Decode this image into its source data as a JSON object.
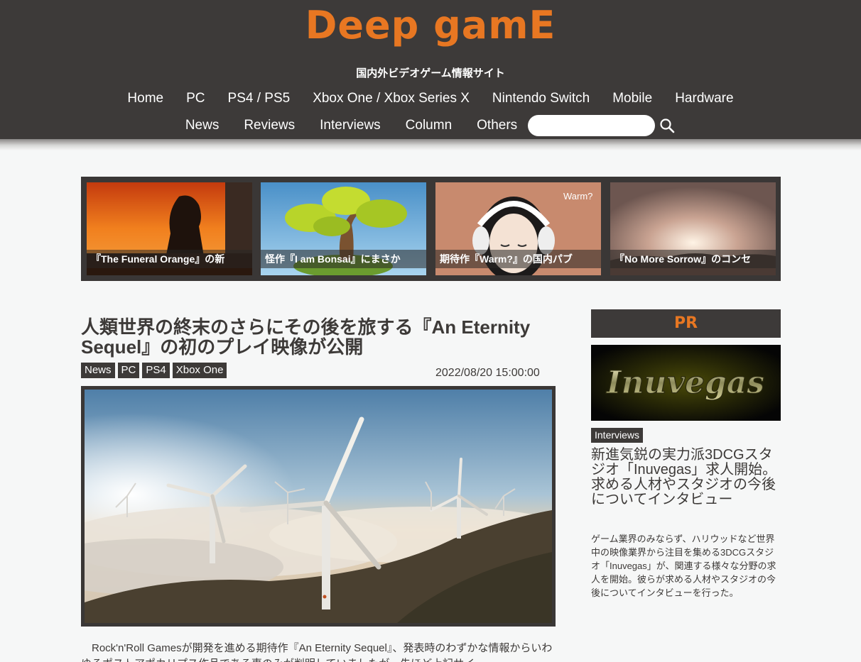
{
  "site": {
    "logo": "Deep gamE",
    "tagline": "国内外ビデオゲーム情報サイト"
  },
  "nav": {
    "row1": [
      "Home",
      "PC",
      "PS4 / PS5",
      "Xbox One / Xbox Series X",
      "Nintendo Switch",
      "Mobile",
      "Hardware"
    ],
    "row2": [
      "News",
      "Reviews",
      "Interviews",
      "Column",
      "Others"
    ],
    "search_placeholder": ""
  },
  "featured": [
    {
      "caption": "『The Funeral Orange』の新"
    },
    {
      "caption": "怪作『I am Bonsai』にまさか"
    },
    {
      "caption": "期待作『Warm?』の国内パブ",
      "image_text": "Warm?"
    },
    {
      "caption": "『No More Sorrow』のコンセ"
    }
  ],
  "article": {
    "title": "人類世界の終末のさらにその後を旅する『An Eternity Sequel』の初のプレイ映像が公開",
    "tags": [
      "News",
      "PC",
      "PS4",
      "Xbox One"
    ],
    "date": "2022/08/20 15:00:00",
    "body": "Rock'n'Roll Gamesが開発を進める期待作『An Eternity Sequel』、発表時のわずかな情報からいわゆるポストアポカリプス作品である事のみが判明していましたが、先ほど上記サイ"
  },
  "sidebar": {
    "pr_label": "PR",
    "banner_text": "Inuvegas",
    "tag": "Interviews",
    "title": "新進気鋭の実力派3DCGスタジオ「Inuvegas」求人開始。求める人材やスタジオの今後についてインタビュー",
    "description": "ゲーム業界のみならず、ハリウッドなど世界中の映像業界から注目を集める3DCGスタジオ「Inuvegas」が、関連する様々な分野の求人を開始。彼らが求める人材やスタジオの今後についてインタビューを行った。"
  },
  "colors": {
    "header_bg": "#3d3a39",
    "accent": "#e87722",
    "page_bg": "#f6f7f7"
  }
}
